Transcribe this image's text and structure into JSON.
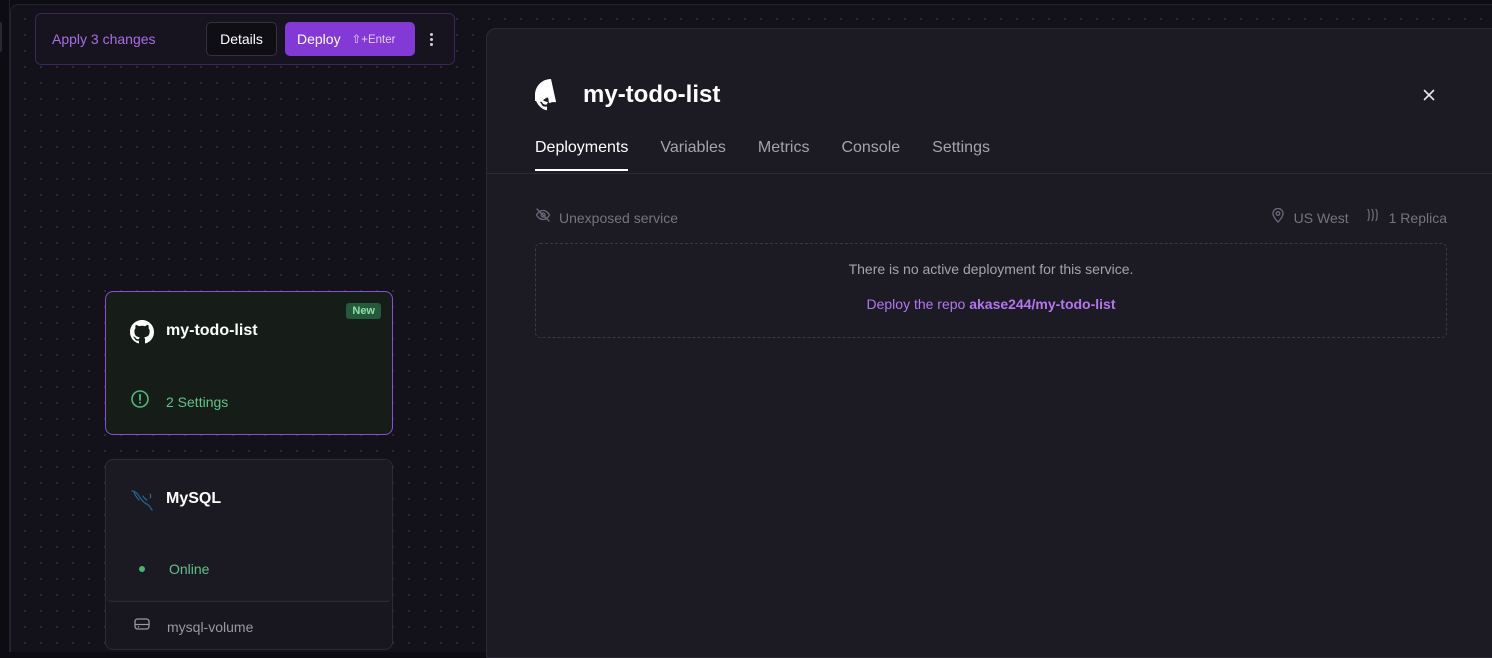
{
  "changes_bar": {
    "apply_label": "Apply 3 changes",
    "details_label": "Details",
    "deploy_label": "Deploy",
    "deploy_shortcut": "⇧+Enter"
  },
  "services": [
    {
      "name": "my-todo-list",
      "icon": "github-icon",
      "badge": "New",
      "status_text": "2 Settings",
      "status_icon": "alert-circle-icon"
    },
    {
      "name": "MySQL",
      "icon": "mysql-dolphin-icon",
      "status_text": "Online",
      "volume": "mysql-volume"
    }
  ],
  "panel": {
    "title": "my-todo-list",
    "tabs": [
      "Deployments",
      "Variables",
      "Metrics",
      "Console",
      "Settings"
    ],
    "active_tab": "Deployments",
    "exposure": "Unexposed service",
    "region": "US West",
    "replicas": "1 Replica",
    "empty_message": "There is no active deployment for this service.",
    "deploy_prefix": "Deploy the repo ",
    "repo": "akase244/my-todo-list"
  },
  "colors": {
    "accent": "#8339d6",
    "accent_text": "#a86ee6",
    "success": "#5ec488",
    "panel_bg": "#1c1a23"
  }
}
